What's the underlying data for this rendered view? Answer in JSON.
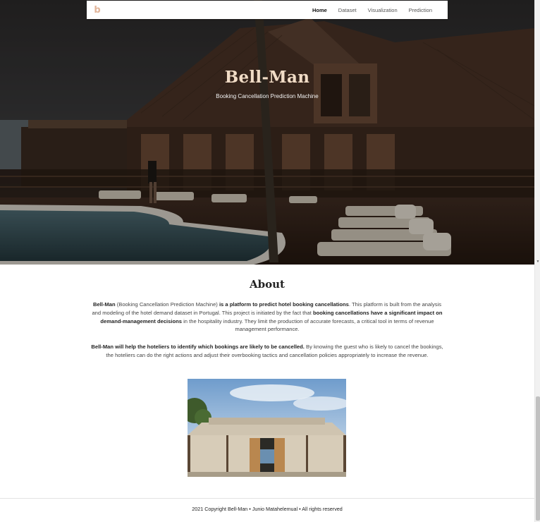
{
  "nav": {
    "logo": "b",
    "items": [
      {
        "label": "Home",
        "active": true
      },
      {
        "label": "Dataset",
        "active": false
      },
      {
        "label": "Visualization",
        "active": false
      },
      {
        "label": "Prediction",
        "active": false
      }
    ]
  },
  "hero": {
    "title": "Bell-Man",
    "subtitle": "Booking Cancellation Prediction Machine"
  },
  "about": {
    "title": "About",
    "p1": {
      "s1": "Bell-Man",
      "s2": " (Booking Cancellation Prediction Machine) ",
      "s3": "is a platform to predict hotel booking cancellations",
      "s4": ". This platform is built from the analysis and modeling of the hotel demand dataset in Portugal. This project is initiated by the fact that ",
      "s5": "booking cancellations have a significant impact on demand-management decisions",
      "s6": " in the hospitality industry. They limit the production of accurate forecasts, a critical tool in terms of revenue management performance."
    },
    "p2": {
      "s1": "Bell-Man will help the hoteliers to identify which bookings are likely to be cancelled.",
      "s2": " By knowing the guest who is likely to cancel the bookings, the hoteliers can do the right actions and adjust their overbooking tactics and cancellation policies appropriately to increase the revenue."
    }
  },
  "footer": {
    "text": "2021 Copyright Bell-Man • Junio Matahelemual • All rights reserved"
  },
  "colors": {
    "accent": "#e2b59a",
    "hero_title": "#f1dcc6"
  }
}
